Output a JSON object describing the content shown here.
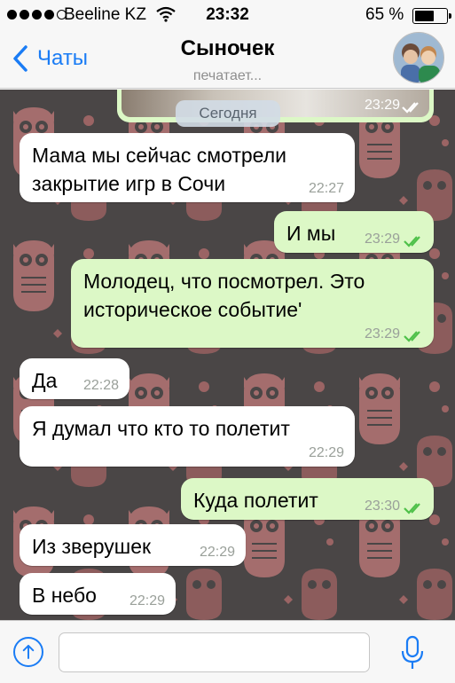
{
  "status_bar": {
    "carrier": "Beeline KZ",
    "time": "23:32",
    "battery": "65 %",
    "battery_level": 0.65
  },
  "header": {
    "back_label": "Чаты",
    "title": "Сыночек",
    "subtitle": "печатает..."
  },
  "chat": {
    "top_photo_time": "23:29",
    "date_label": "Сегодня",
    "messages": [
      {
        "direction": "in",
        "lines": [
          "Мама мы сейчас смотрели",
          "закрытие игр в Сочи"
        ],
        "time": "22:27"
      },
      {
        "direction": "out",
        "lines": [
          "И мы"
        ],
        "time": "23:29"
      },
      {
        "direction": "out",
        "lines": [
          "Молодец, что посмотрел. Это",
          "историческое событие'"
        ],
        "time": "23:29"
      },
      {
        "direction": "in",
        "lines": [
          "Да"
        ],
        "time": "22:28"
      },
      {
        "direction": "in",
        "lines": [
          "Я думал что кто то полетит"
        ],
        "time": "22:29"
      },
      {
        "direction": "out",
        "lines": [
          "Куда полетит"
        ],
        "time": "23:30"
      },
      {
        "direction": "in",
        "lines": [
          "Из зверушек"
        ],
        "time": "22:29"
      },
      {
        "direction": "in",
        "lines": [
          "В небо"
        ],
        "time": "22:29"
      }
    ]
  },
  "input": {
    "value": "",
    "placeholder": ""
  },
  "colors": {
    "accent": "#1a7cf5",
    "outgoing_bubble": "#dcf8c6",
    "incoming_bubble": "#ffffff",
    "wallpaper": "#4a4646",
    "read_ticks": "#4fc14a"
  }
}
